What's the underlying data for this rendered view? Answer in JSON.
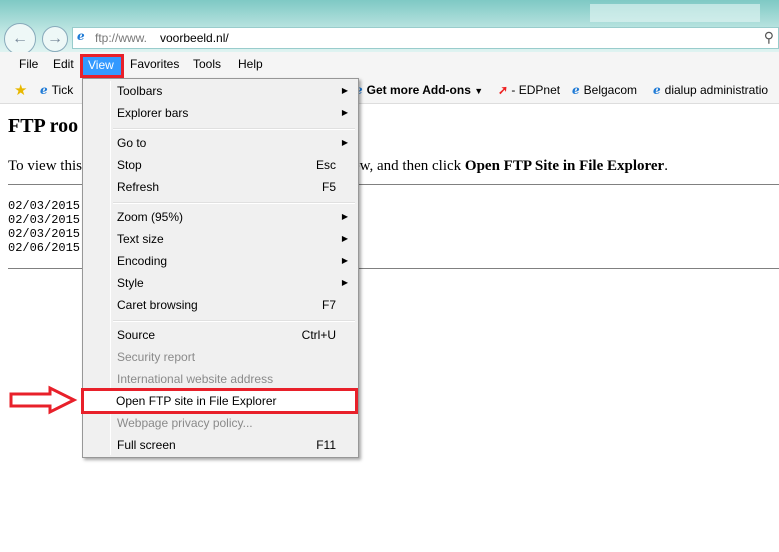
{
  "browser": {
    "address": "ftp://www.voorbeeld.nl/",
    "address_host": "voorbeeld.nl/",
    "address_prefix": "ftp://www."
  },
  "menubar": [
    "File",
    "Edit",
    "View",
    "Favorites",
    "Tools",
    "Help"
  ],
  "favorites": {
    "tick": "Tick",
    "addons": "Get more Add-ons",
    "edpnet": "- EDPnet",
    "belgacom": "Belgacom",
    "dialup": "dialup administratio"
  },
  "page": {
    "heading": "FTP roo",
    "text_left": "To view this",
    "text_right": "ew, and then click ",
    "text_bold": "Open FTP Site in File Explorer",
    "text_end": ".",
    "dates": [
      "02/03/2015",
      "02/03/2015",
      "02/03/2015",
      "02/06/2015"
    ]
  },
  "menu": {
    "items": [
      {
        "label": "Toolbars",
        "sub": true
      },
      {
        "label": "Explorer bars",
        "sub": true
      },
      {
        "label": "Go to",
        "sub": true
      },
      {
        "label": "Stop",
        "shortcut": "Esc"
      },
      {
        "label": "Refresh",
        "shortcut": "F5"
      },
      {
        "label": "Zoom (95%)",
        "sub": true
      },
      {
        "label": "Text size",
        "sub": true
      },
      {
        "label": "Encoding",
        "sub": true
      },
      {
        "label": "Style",
        "sub": true
      },
      {
        "label": "Caret browsing",
        "shortcut": "F7"
      },
      {
        "label": "Source",
        "shortcut": "Ctrl+U"
      },
      {
        "label": "Security report",
        "disabled": true
      },
      {
        "label": "International website address",
        "disabled": true
      },
      {
        "label": "Open FTP site in File Explorer",
        "highlighted": true
      },
      {
        "label": "Webpage privacy policy...",
        "disabled": true
      },
      {
        "label": "Full screen",
        "shortcut": "F11"
      }
    ]
  },
  "colors": {
    "highlight_red": "#e8202a",
    "menu_selected": "#3399ff"
  }
}
